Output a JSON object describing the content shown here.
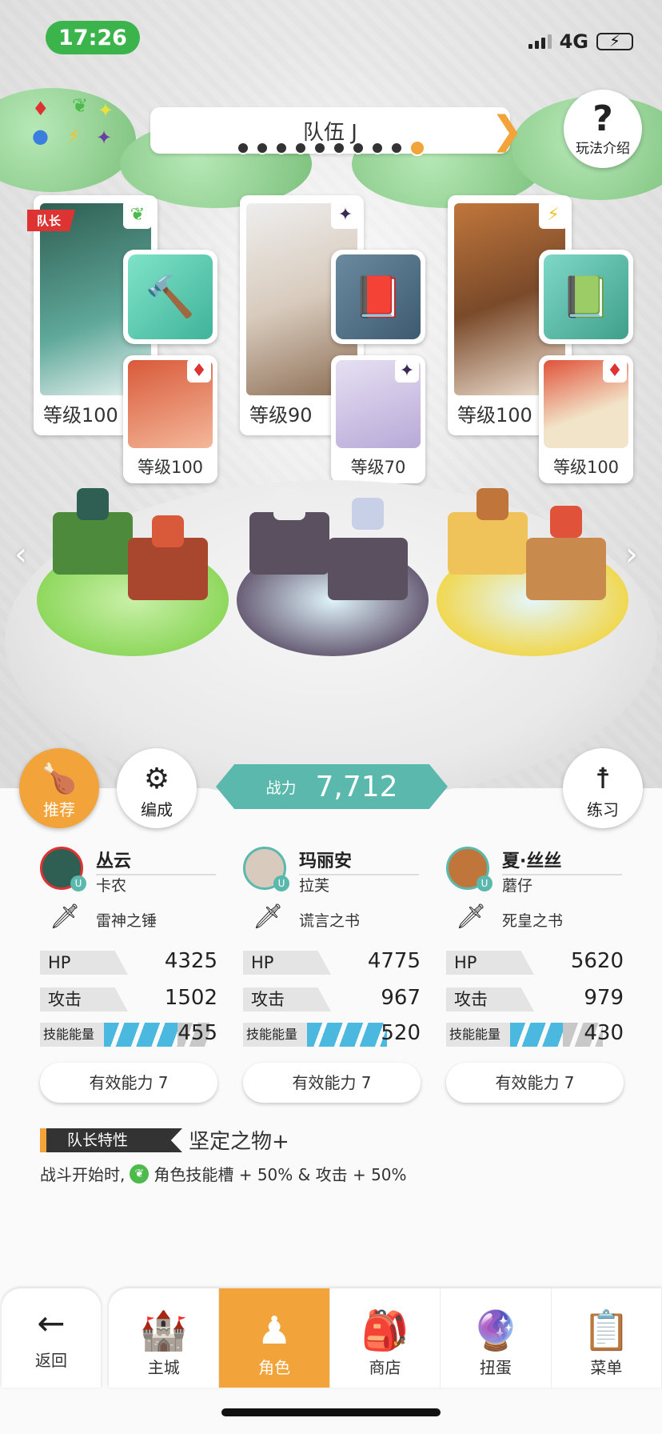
{
  "status": {
    "time": "17:26",
    "network": "4G"
  },
  "elements_wheel": [
    "♦",
    "⟡",
    "✦",
    "●",
    "⚡",
    "✦"
  ],
  "team": {
    "name": "队伍 J",
    "page_count": 10,
    "active_index": 9
  },
  "help": {
    "label": "玩法介绍"
  },
  "leader_tag": "队长",
  "characters": [
    {
      "name": "丛云",
      "class": "卡农",
      "element": "leaf",
      "level": "等级100",
      "weapon": "雷神之锤",
      "hp": "4325",
      "atk": "1502",
      "skill": "455",
      "effective": "有效能力 7",
      "sub": {
        "level": "等级100",
        "element": "♦"
      },
      "portrait_color": "#3f7a6c",
      "equip_color": "#5fc8b8"
    },
    {
      "name": "玛丽安",
      "class": "拉芙",
      "element": "dark",
      "level": "等级90",
      "weapon": "谎言之书",
      "hp": "4775",
      "atk": "967",
      "skill": "520",
      "effective": "有效能力 7",
      "sub": {
        "level": "等级70",
        "element": "✦"
      },
      "portrait_color": "#d8cbbd",
      "equip_color": "#4a6d85"
    },
    {
      "name": "夏·丝丝",
      "class": "蘑仔",
      "element": "bolt",
      "level": "等级100",
      "weapon": "死皇之书",
      "hp": "5620",
      "atk": "979",
      "skill": "430",
      "effective": "有效能力 7",
      "sub": {
        "level": "等级100",
        "element": "♦"
      },
      "portrait_color": "#c0763b",
      "equip_color": "#4fb3a2"
    }
  ],
  "stat_labels": {
    "hp": "HP",
    "atk": "攻击",
    "skill": "技能能量"
  },
  "buttons": {
    "recommend": "推荐",
    "formation": "编成",
    "practice": "练习"
  },
  "power": {
    "label": "战力",
    "value": "7,712"
  },
  "leader_trait": {
    "title": "队长特性",
    "name": "坚定之物+",
    "desc_prefix": "战斗开始时,",
    "desc_body": "角色技能槽 + 50% & 攻击 + 50%"
  },
  "nav": {
    "back": "返回",
    "tabs": [
      "主城",
      "角色",
      "商店",
      "扭蛋",
      "菜单"
    ],
    "active": "角色"
  },
  "colors": {
    "accent": "#f2a33a",
    "teal": "#5ab8ad",
    "skill_blue": "#4bb8e0",
    "leader_red": "#d33"
  }
}
